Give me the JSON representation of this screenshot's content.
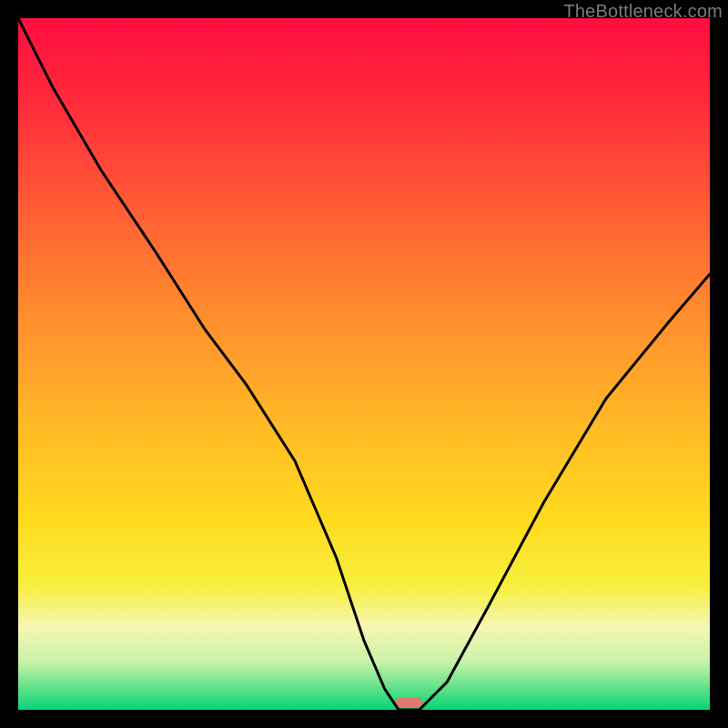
{
  "watermark": {
    "text": "TheBottleneck.com"
  },
  "chart_data": {
    "type": "line",
    "title": "",
    "xlabel": "",
    "ylabel": "",
    "xlim": [
      0,
      100
    ],
    "ylim": [
      0,
      100
    ],
    "background": {
      "type": "vertical-gradient",
      "stops": [
        {
          "pos": 0.0,
          "color": "#ff0d3f"
        },
        {
          "pos": 0.12,
          "color": "#ff2a3b"
        },
        {
          "pos": 0.28,
          "color": "#ff5e34"
        },
        {
          "pos": 0.42,
          "color": "#ff8a2e"
        },
        {
          "pos": 0.58,
          "color": "#ffb726"
        },
        {
          "pos": 0.72,
          "color": "#ffd91e"
        },
        {
          "pos": 0.82,
          "color": "#f7ef3b"
        },
        {
          "pos": 0.88,
          "color": "#f6f6b3"
        },
        {
          "pos": 0.93,
          "color": "#c9f3a8"
        },
        {
          "pos": 0.965,
          "color": "#6ae28c"
        },
        {
          "pos": 1.0,
          "color": "#05d57c"
        }
      ]
    },
    "series": [
      {
        "name": "bottleneck-curve",
        "x": [
          0,
          5,
          12,
          20,
          27,
          33,
          40,
          46,
          50,
          53,
          55,
          58,
          62,
          68,
          76,
          85,
          94,
          100
        ],
        "y": [
          100,
          90,
          78,
          66,
          55,
          47,
          36,
          22,
          10,
          3,
          0,
          0,
          4,
          15,
          30,
          45,
          56,
          63
        ]
      }
    ],
    "marker": {
      "name": "optimal-marker",
      "x_center": 56.5,
      "width": 4,
      "color": "#e07a6f"
    }
  }
}
